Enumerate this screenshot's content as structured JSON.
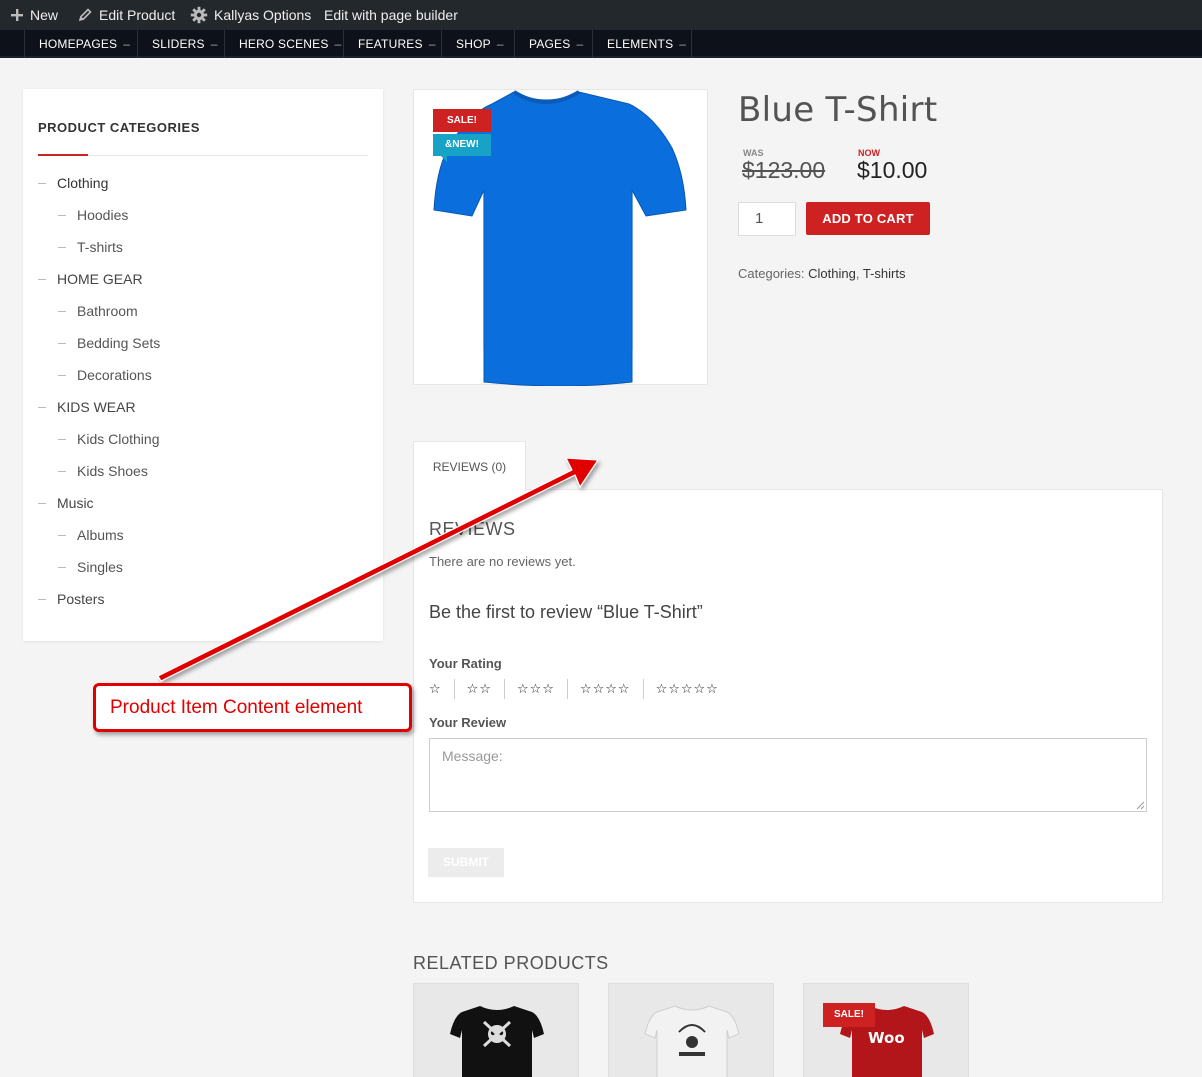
{
  "admin_bar": {
    "new_label": "New",
    "edit_product_label": "Edit Product",
    "kallyas_options_label": "Kallyas Options",
    "edit_builder_label": "Edit with page builder"
  },
  "main_nav": {
    "items": [
      "HOMEPAGES",
      "SLIDERS",
      "HERO SCENES",
      "FEATURES",
      "SHOP",
      "PAGES",
      "ELEMENTS"
    ],
    "caret": "–"
  },
  "sidebar": {
    "title": "PRODUCT CATEGORIES",
    "categories": [
      {
        "label": "Clothing"
      },
      {
        "label": "Hoodies"
      },
      {
        "label": "T-shirts"
      },
      {
        "label": "HOME GEAR"
      },
      {
        "label": "Bathroom"
      },
      {
        "label": "Bedding Sets"
      },
      {
        "label": "Decorations"
      },
      {
        "label": "KIDS WEAR"
      },
      {
        "label": "Kids Clothing"
      },
      {
        "label": "Kids Shoes"
      },
      {
        "label": "Music"
      },
      {
        "label": "Albums"
      },
      {
        "label": "Singles"
      },
      {
        "label": "Posters"
      }
    ]
  },
  "product": {
    "badge_sale": "SALE!",
    "badge_new": "&NEW!",
    "title": "Blue T-Shirt",
    "was_label": "WAS",
    "now_label": "NOW",
    "old_price": "$123.00",
    "new_price": "$10.00",
    "quantity": "1",
    "add_to_cart": "ADD TO CART",
    "categories_label": "Categories:",
    "categories": [
      "Clothing",
      "T-shirts"
    ],
    "category_separator": ",",
    "shirt_color": "#0a6fdc"
  },
  "reviews": {
    "tab_label": "REVIEWS (0)",
    "heading": "REVIEWS",
    "none_text": "There are no reviews yet.",
    "first_review": "Be the first to review “Blue T-Shirt”",
    "rating_label": "Your Rating",
    "rating_options": [
      "☆",
      "☆☆",
      "☆☆☆",
      "☆☆☆☆",
      "☆☆☆☆☆"
    ],
    "review_label": "Your Review",
    "message_placeholder": "Message:",
    "submit_label": "SUBMIT"
  },
  "annotation": {
    "text": "Product Item Content element",
    "color": "#e00000"
  },
  "related": {
    "title": "RELATED PRODUCTS",
    "sale_badge": "SALE!",
    "woo_text": "Woo"
  },
  "colors": {
    "accent": "#cd2122",
    "new_badge": "#17a2c6"
  }
}
